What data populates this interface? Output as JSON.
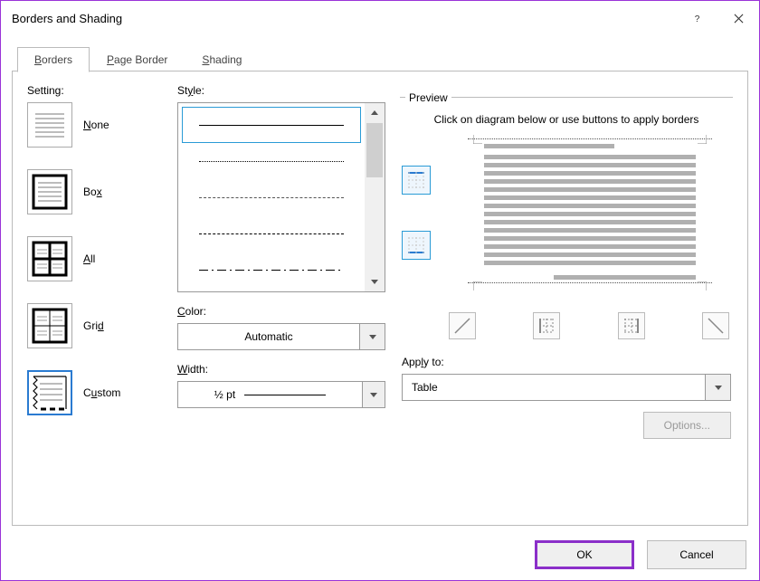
{
  "window": {
    "title": "Borders and Shading"
  },
  "tabs": {
    "borders": "Borders",
    "page_border": "Page Border",
    "shading": "Shading"
  },
  "labels": {
    "setting": "Setting:",
    "style": "Style:",
    "color": "Color:",
    "width": "Width:",
    "preview": "Preview",
    "preview_hint": "Click on diagram below or use buttons to apply borders",
    "apply_to": "Apply to:",
    "options": "Options..."
  },
  "setting_options": {
    "none": "None",
    "box": "Box",
    "all": "All",
    "grid": "Grid",
    "custom": "Custom"
  },
  "color": {
    "value": "Automatic"
  },
  "width": {
    "value": "½ pt"
  },
  "apply_to": {
    "value": "Table"
  },
  "buttons": {
    "ok": "OK",
    "cancel": "Cancel"
  }
}
